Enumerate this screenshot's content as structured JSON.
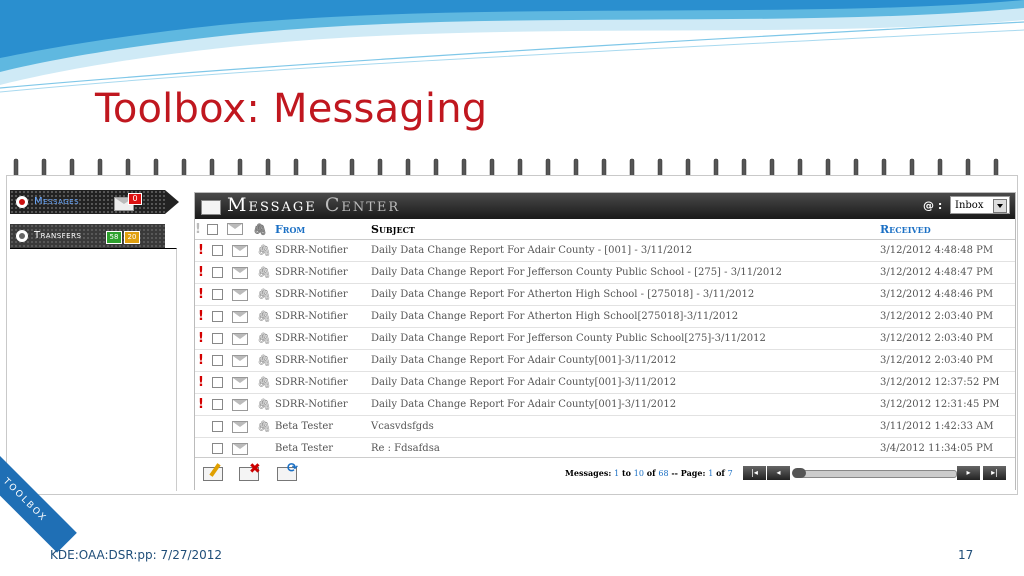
{
  "slide": {
    "title": "Toolbox: Messaging",
    "footer_left": "KDE:OAA:DSR:pp: 7/27/2012",
    "page_number": "17"
  },
  "sidebar": {
    "messages": {
      "label": "Messages",
      "badge": "0",
      "icon": "envelope-icon"
    },
    "transfers": {
      "label": "Transfers",
      "badge_green": "58",
      "badge_yellow": "20"
    },
    "ribbon": "TOOLBOX"
  },
  "message_center": {
    "title_main": "Message",
    "title_sub": "Center",
    "at_label": "@ :",
    "folder": "Inbox",
    "columns": {
      "from": "From",
      "subject": "Subject",
      "received": "Received"
    },
    "rows": [
      {
        "flag": "!",
        "from": "SDRR-Notifier",
        "subject": "Daily Data Change Report For Adair County - [001] - 3/11/2012",
        "received": "3/12/2012 4:48:48 PM"
      },
      {
        "flag": "!",
        "from": "SDRR-Notifier",
        "subject": "Daily Data Change Report For Jefferson County Public School - [275] - 3/11/2012",
        "received": "3/12/2012 4:48:47 PM"
      },
      {
        "flag": "!",
        "from": "SDRR-Notifier",
        "subject": "Daily Data Change Report For Atherton High School - [275018] - 3/11/2012",
        "received": "3/12/2012 4:48:46 PM"
      },
      {
        "flag": "!",
        "from": "SDRR-Notifier",
        "subject": "Daily Data Change Report For Atherton High School[275018]-3/11/2012",
        "received": "3/12/2012 2:03:40 PM"
      },
      {
        "flag": "!",
        "from": "SDRR-Notifier",
        "subject": "Daily Data Change Report For Jefferson County Public School[275]-3/11/2012",
        "received": "3/12/2012 2:03:40 PM"
      },
      {
        "flag": "!",
        "from": "SDRR-Notifier",
        "subject": "Daily Data Change Report For Adair County[001]-3/11/2012",
        "received": "3/12/2012 2:03:40 PM"
      },
      {
        "flag": "!",
        "from": "SDRR-Notifier",
        "subject": "Daily Data Change Report For Adair County[001]-3/11/2012",
        "received": "3/12/2012 12:37:52 PM"
      },
      {
        "flag": "!",
        "from": "SDRR-Notifier",
        "subject": "Daily Data Change Report For Adair County[001]-3/11/2012",
        "received": "3/12/2012 12:31:45 PM"
      },
      {
        "flag": "",
        "from": "Beta Tester",
        "subject": "Vcasvdsfgds",
        "received": "3/11/2012 1:42:33 AM"
      },
      {
        "flag": "",
        "from": "Beta Tester",
        "subject": "Re : Fdsafdsa",
        "received": "3/4/2012 11:34:05 PM"
      }
    ],
    "pager": {
      "messages_label": "Messages:",
      "from": "1",
      "to_label": "to",
      "to": "10",
      "of_label": "of",
      "total": "68",
      "sep": "--",
      "page_label": "Page:",
      "page": "1",
      "pages": "7"
    },
    "nav": {
      "first": "|◂",
      "prev": "◂",
      "next": "▸",
      "last": "▸|"
    },
    "colors": {
      "flag": "#d40000",
      "link": "#1a6fc4",
      "title": "#c0171f"
    }
  }
}
